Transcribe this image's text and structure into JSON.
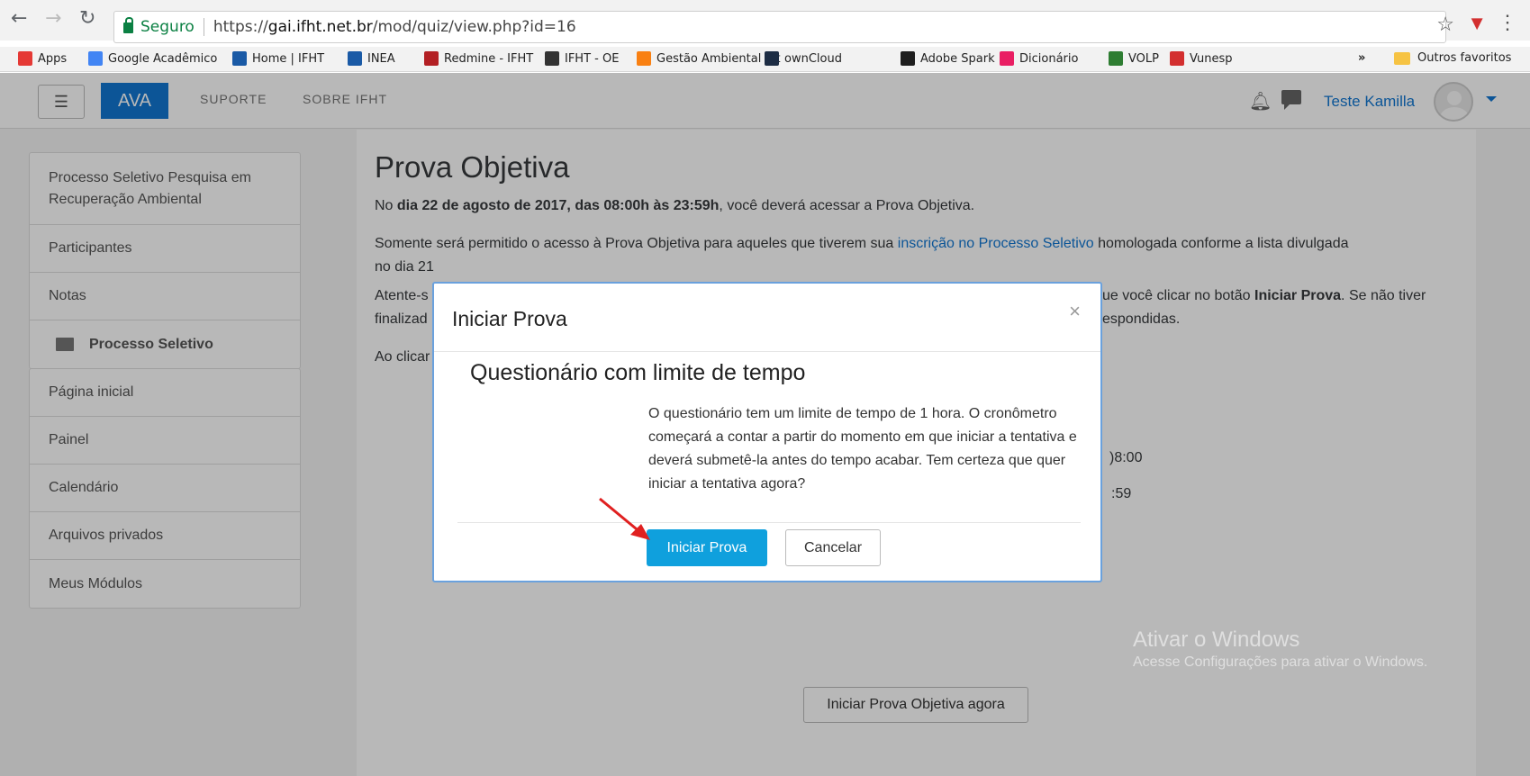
{
  "browser": {
    "secure_label": "Seguro",
    "url_scheme": "https://",
    "url_host": "gai.ifht.net.br",
    "url_path": "/mod/quiz/view.php?id=16",
    "bookmarks": [
      {
        "label": "Apps",
        "icon": "apps-grid-icon",
        "color": "#e53935"
      },
      {
        "label": "Google Acadêmico",
        "icon": "google-scholar-icon",
        "color": "#4285f4"
      },
      {
        "label": "Home | IFHT",
        "icon": "ifht-icon",
        "color": "#1a5aa6"
      },
      {
        "label": "INEA",
        "icon": "ifht-icon",
        "color": "#1a5aa6"
      },
      {
        "label": "Redmine - IFHT",
        "icon": "redmine-icon",
        "color": "#b32024"
      },
      {
        "label": "IFHT - OE",
        "icon": "moodle-icon",
        "color": "#333333"
      },
      {
        "label": "Gestão Ambiental Int",
        "icon": "moodle-hat-icon",
        "color": "#f98012"
      },
      {
        "label": "ownCloud",
        "icon": "owncloud-icon",
        "color": "#1d2d44"
      },
      {
        "label": "Adobe Spark",
        "icon": "adobe-spark-icon",
        "color": "#1e1e1e"
      },
      {
        "label": "Dicionário",
        "icon": "dictionary-icon",
        "color": "#e91e63"
      },
      {
        "label": "VOLP",
        "icon": "volp-icon",
        "color": "#2e7d32"
      },
      {
        "label": "Vunesp",
        "icon": "vunesp-icon",
        "color": "#d32f2f"
      }
    ],
    "overflow_label": "»",
    "other_bookmarks": "Outros favoritos"
  },
  "navbar": {
    "brand": "AVA",
    "links": [
      "SUPORTE",
      "SOBRE IFHT"
    ],
    "user_name": "Teste Kamilla"
  },
  "sidebar": {
    "course_block": [
      {
        "label": "Processo Seletivo Pesquisa em Recuperação Ambiental"
      },
      {
        "label": "Participantes"
      },
      {
        "label": "Notas"
      },
      {
        "label": "Processo Seletivo"
      }
    ],
    "nav_block": [
      {
        "label": "Página inicial"
      },
      {
        "label": "Painel"
      },
      {
        "label": "Calendário"
      },
      {
        "label": "Arquivos privados"
      },
      {
        "label": "Meus Módulos"
      }
    ]
  },
  "main": {
    "title": "Prova Objetiva",
    "p1_pre": "No ",
    "p1_bold": "dia 22 de agosto de 2017, das 08:00h às 23:59h",
    "p1_post": ", você deverá acessar a Prova Objetiva.",
    "p2_pre": "Somente será permitido o acesso à Prova Objetiva para aqueles que tiverem sua ",
    "p2_link": "inscrição no Processo Seletivo",
    "p2_post": " homologada conforme a lista divulgada",
    "p2_line2": "no dia 21",
    "p3_left": "Atente-s",
    "p3_right_pre": "ue você clicar no botão ",
    "p3_right_bold": "Iniciar Prova",
    "p3_right_post": ". Se não tiver",
    "p3_line2_left": "finalizad",
    "p3_line2_right": "espondidas.",
    "p4_left": "Ao clicar",
    "time_open_peek": ")8:00",
    "time_close_peek": ":59",
    "start_button": "Iniciar Prova Objetiva agora"
  },
  "modal": {
    "title": "Iniciar Prova",
    "close": "×",
    "subtitle": "Questionário com limite de tempo",
    "text": "O questionário tem um limite de tempo de 1 hora. O cronômetro começará a contar a partir do momento em que iniciar a tentativa e deverá submetê-la antes do tempo acabar. Tem certeza que quer iniciar a tentativa agora?",
    "start_button": "Iniciar Prova",
    "cancel_button": "Cancelar"
  },
  "watermark": {
    "line1": "Ativar o Windows",
    "line2": "Acesse Configurações para ativar o Windows."
  },
  "colors": {
    "accent": "#1177d1",
    "primary_button": "#0fa0dd",
    "annotation_arrow": "#e02020"
  }
}
